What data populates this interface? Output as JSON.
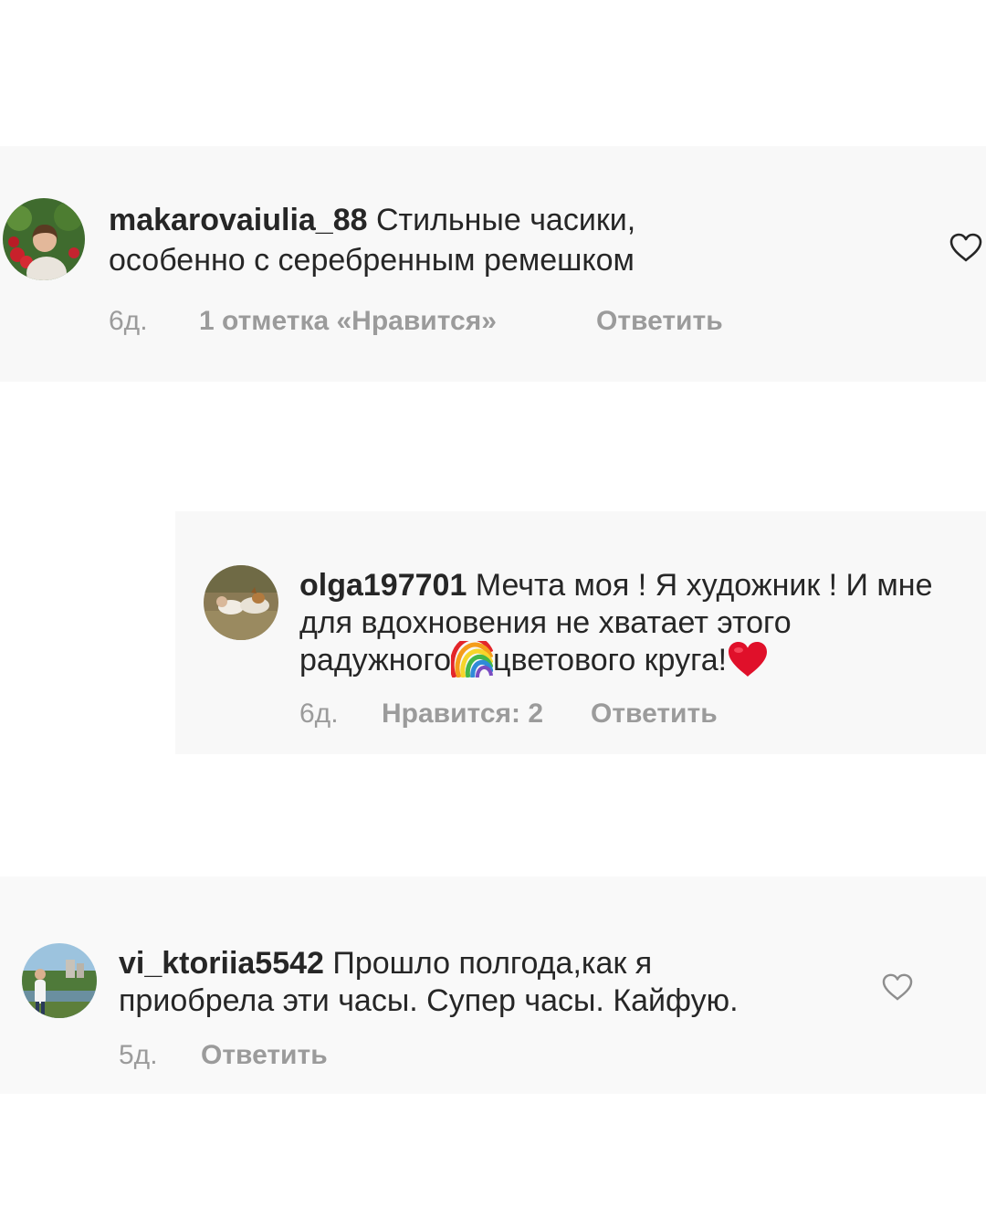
{
  "comments": [
    {
      "username": "makarovaiulia_88",
      "text_line1": " Стильные часики,",
      "text_line2": "особенно с серебренным ремешком",
      "time": "6д.",
      "likes": "1 отметка «Нравится»",
      "reply": "Ответить",
      "avatar_icon": "avatar-photo-woman-with-roses",
      "like_icon": "heart-outline-icon"
    },
    {
      "username": "olga197701",
      "text_line1": " Мечта моя ! Я художник ! И мне",
      "text_line2": "для вдохновения не хватает этого",
      "text_line3_a": "радужного",
      "text_line3_b": "цветового круга!",
      "emoji_1": "rainbow-emoji",
      "emoji_2": "red-heart-emoji",
      "time": "6д.",
      "likes": "Нравится: 2",
      "reply": "Ответить",
      "avatar_icon": "avatar-photo-woman-with-dog"
    },
    {
      "username": "vi_ktoriia5542",
      "text_line1": " Прошло полгода,как я",
      "text_line2": "приобрела эти часы. Супер часы. Кайфую.",
      "time": "5д.",
      "reply": "Ответить",
      "avatar_icon": "avatar-photo-woman-by-river",
      "like_icon": "heart-outline-icon"
    }
  ],
  "colors": {
    "text": "#262626",
    "secondary": "#9b9b9b",
    "panel": "#f8f8f8",
    "heart_red": "#e0102a"
  }
}
